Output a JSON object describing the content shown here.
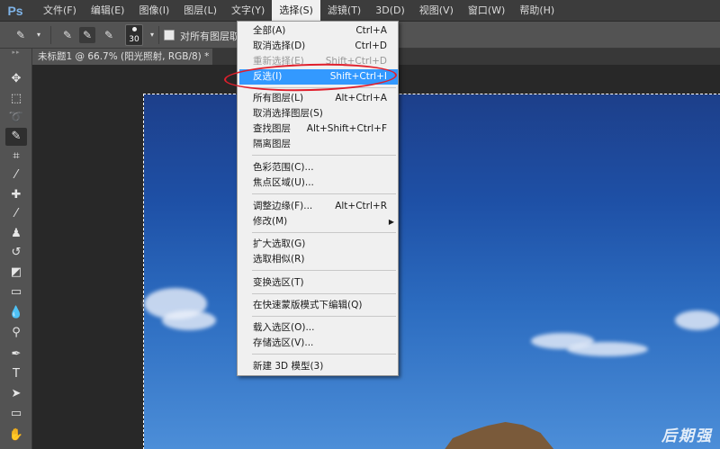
{
  "menubar": {
    "logo": "Ps",
    "items": [
      "文件(F)",
      "编辑(E)",
      "图像(I)",
      "图层(L)",
      "文字(Y)",
      "选择(S)",
      "滤镜(T)",
      "3D(D)",
      "视图(V)",
      "窗口(W)",
      "帮助(H)"
    ],
    "active_index": 5
  },
  "options_bar": {
    "brush_size": "30",
    "sample_all_label": "对所有图层取样"
  },
  "document_tab": {
    "title": "未标题1 @ 66.7% (阳光照射, RGB/8) *"
  },
  "select_menu": {
    "items": [
      {
        "label": "全部(A)",
        "shortcut": "Ctrl+A"
      },
      {
        "label": "取消选择(D)",
        "shortcut": "Ctrl+D"
      },
      {
        "label": "重新选择(E)",
        "shortcut": "Shift+Ctrl+D",
        "disabled": true
      },
      {
        "label": "反选(I)",
        "shortcut": "Shift+Ctrl+I",
        "highlight": true
      },
      {
        "label": "所有图层(L)",
        "shortcut": "Alt+Ctrl+A"
      },
      {
        "label": "取消选择图层(S)",
        "shortcut": ""
      },
      {
        "label": "查找图层",
        "shortcut": "Alt+Shift+Ctrl+F"
      },
      {
        "label": "隔离图层",
        "shortcut": ""
      },
      {
        "label": "色彩范围(C)...",
        "shortcut": ""
      },
      {
        "label": "焦点区域(U)...",
        "shortcut": ""
      },
      {
        "label": "调整边缘(F)...",
        "shortcut": "Alt+Ctrl+R"
      },
      {
        "label": "修改(M)",
        "shortcut": "",
        "submenu": true
      },
      {
        "label": "扩大选取(G)",
        "shortcut": ""
      },
      {
        "label": "选取相似(R)",
        "shortcut": ""
      },
      {
        "label": "变换选区(T)",
        "shortcut": ""
      },
      {
        "label": "在快速蒙版模式下编辑(Q)",
        "shortcut": ""
      },
      {
        "label": "载入选区(O)...",
        "shortcut": ""
      },
      {
        "label": "存储选区(V)...",
        "shortcut": ""
      },
      {
        "label": "新建 3D 模型(3)",
        "shortcut": ""
      }
    ]
  },
  "watermark": "后期强",
  "colors": {
    "highlight": "#3399ff",
    "annotation": "#e01f2c",
    "menubar": "#3c3c3c",
    "panel": "#535353"
  }
}
